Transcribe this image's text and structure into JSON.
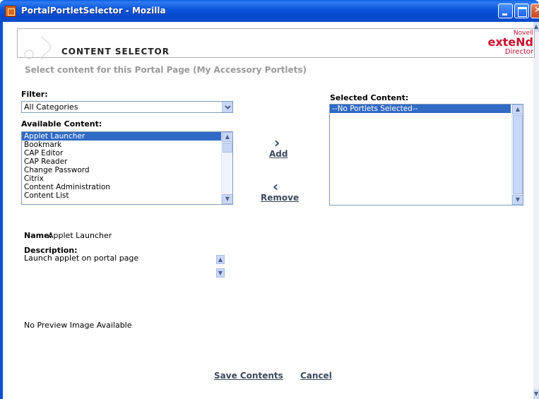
{
  "window": {
    "title": "PortalPortletSelector - Mozilla"
  },
  "header": {
    "title": "CONTENT SELECTOR",
    "brand_line1": "Novell",
    "brand_line2": "exteNd",
    "brand_line3": "Director"
  },
  "subtitle": "Select content for this Portal Page (My Accessory Portlets)",
  "filter": {
    "label": "Filter:",
    "selected": "All Categories"
  },
  "available": {
    "label": "Available Content:",
    "items": [
      "Applet Launcher",
      "Bookmark",
      "CAP Editor",
      "CAP Reader",
      "Change Password",
      "Citrix",
      "Content Administration",
      "Content List"
    ],
    "selected_index": 0
  },
  "selected_content": {
    "label": "Selected Content:",
    "items": [
      "--No Portlets Selected--"
    ]
  },
  "actions": {
    "add": "Add",
    "remove": "Remove"
  },
  "details": {
    "name_label": "Name:",
    "name_value": "Applet Launcher",
    "description_label": "Description:",
    "description_value": "Launch applet on portal page",
    "preview": "No Preview Image Available"
  },
  "footer": {
    "save": "Save Contents",
    "cancel": "Cancel"
  }
}
